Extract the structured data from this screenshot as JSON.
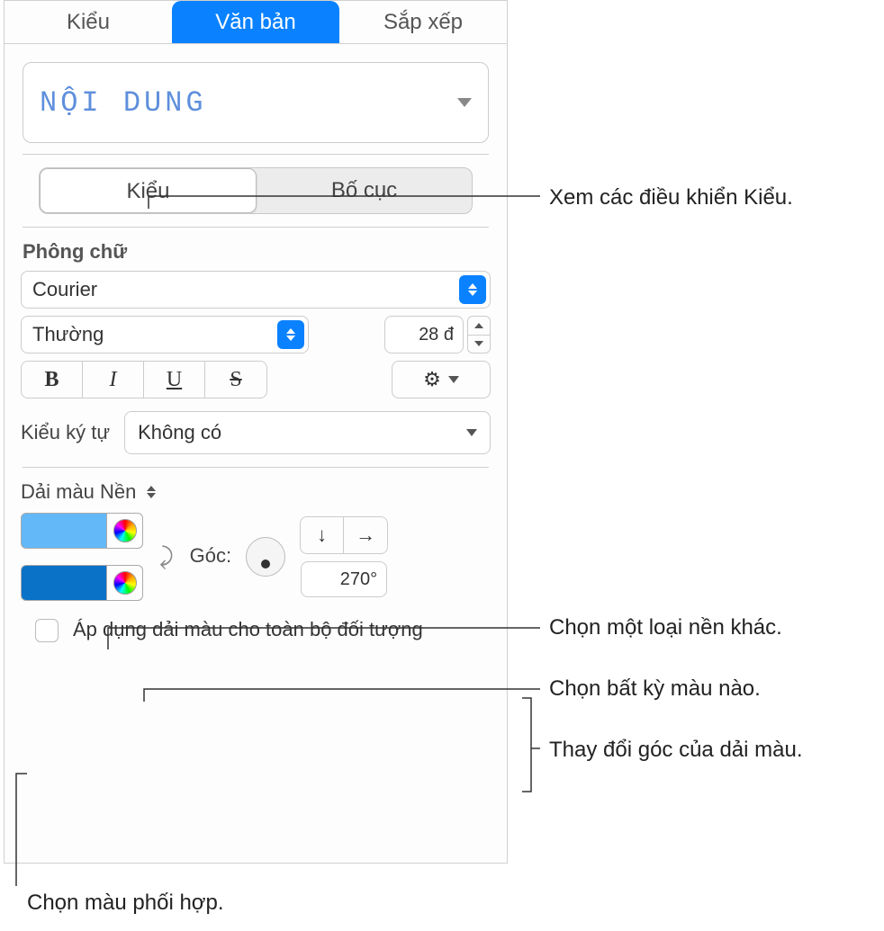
{
  "topTabs": {
    "style": "Kiểu",
    "text": "Văn bản",
    "arrange": "Sắp xếp"
  },
  "stylePick": "NỘI DUNG",
  "seg": {
    "style": "Kiểu",
    "layout": "Bố cục"
  },
  "font": {
    "section": "Phông chữ",
    "family": "Courier",
    "weight": "Thường",
    "size": "28 đ",
    "charStyleLabel": "Kiểu ký tự",
    "charStyleValue": "Không có"
  },
  "bg": {
    "label": "Dải màu Nền",
    "color1": "#63b8f7",
    "color2": "#0a72c7",
    "angleLabel": "Góc:",
    "angleValue": "270°",
    "applyLabel": "Áp dụng dải màu cho toàn bộ đối tượng"
  },
  "callouts": {
    "styleControls": "Xem các điều khiển Kiểu.",
    "bgType": "Chọn một loại nền khác.",
    "anyColor": "Chọn bất kỳ màu nào.",
    "angle": "Thay đổi góc của dải màu.",
    "matchColor": "Chọn màu phối hợp."
  }
}
